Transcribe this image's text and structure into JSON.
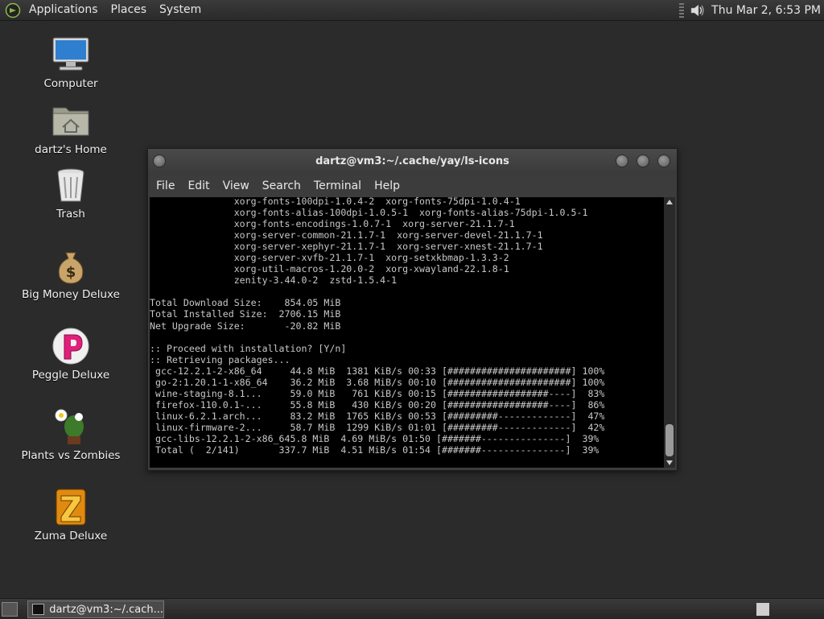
{
  "top_panel": {
    "menus": [
      "Applications",
      "Places",
      "System"
    ],
    "clock": "Thu Mar  2,  6:53 PM",
    "volume_icon": "speaker-icon"
  },
  "desktop_icons": [
    {
      "label": "Computer",
      "icon": "computer-icon"
    },
    {
      "label": "dartz's Home",
      "icon": "home-folder-icon"
    },
    {
      "label": "Trash",
      "icon": "trash-icon"
    },
    {
      "label": "Big Money Deluxe",
      "icon": "money-bag-icon"
    },
    {
      "label": "Peggle Deluxe",
      "icon": "peggle-icon"
    },
    {
      "label": "Plants vs Zombies",
      "icon": "plants-icon"
    },
    {
      "label": "Zuma Deluxe",
      "icon": "zuma-icon"
    }
  ],
  "terminal": {
    "title": "dartz@vm3:~/.cache/yay/ls-icons",
    "menus": [
      "File",
      "Edit",
      "View",
      "Search",
      "Terminal",
      "Help"
    ],
    "lines": [
      "               xorg-fonts-100dpi-1.0.4-2  xorg-fonts-75dpi-1.0.4-1",
      "               xorg-fonts-alias-100dpi-1.0.5-1  xorg-fonts-alias-75dpi-1.0.5-1",
      "               xorg-fonts-encodings-1.0.7-1  xorg-server-21.1.7-1",
      "               xorg-server-common-21.1.7-1  xorg-server-devel-21.1.7-1",
      "               xorg-server-xephyr-21.1.7-1  xorg-server-xnest-21.1.7-1",
      "               xorg-server-xvfb-21.1.7-1  xorg-setxkbmap-1.3.3-2",
      "               xorg-util-macros-1.20.0-2  xorg-xwayland-22.1.8-1",
      "               zenity-3.44.0-2  zstd-1.5.4-1",
      "",
      "Total Download Size:    854.05 MiB",
      "Total Installed Size:  2706.15 MiB",
      "Net Upgrade Size:       -20.82 MiB",
      "",
      ":: Proceed with installation? [Y/n]",
      ":: Retrieving packages...",
      " gcc-12.2.1-2-x86_64     44.8 MiB  1381 KiB/s 00:33 [######################] 100%",
      " go-2:1.20.1-1-x86_64    36.2 MiB  3.68 MiB/s 00:10 [######################] 100%",
      " wine-staging-8.1...     59.0 MiB   761 KiB/s 00:15 [##################----]  83%",
      " firefox-110.0.1-...     55.8 MiB   430 KiB/s 00:20 [##################----]  86%",
      " linux-6.2.1.arch...     83.2 MiB  1765 KiB/s 00:53 [#########-------------]  47%",
      " linux-firmware-2...     58.7 MiB  1299 KiB/s 01:01 [#########-------------]  42%",
      " gcc-libs-12.2.1-2-x86_645.8 MiB  4.69 MiB/s 01:50 [#######---------------]  39%",
      " Total (  2/141)       337.7 MiB  4.51 MiB/s 01:54 [#######---------------]  39%"
    ]
  },
  "bottom_panel": {
    "task_label": "dartz@vm3:~/.cach..."
  }
}
